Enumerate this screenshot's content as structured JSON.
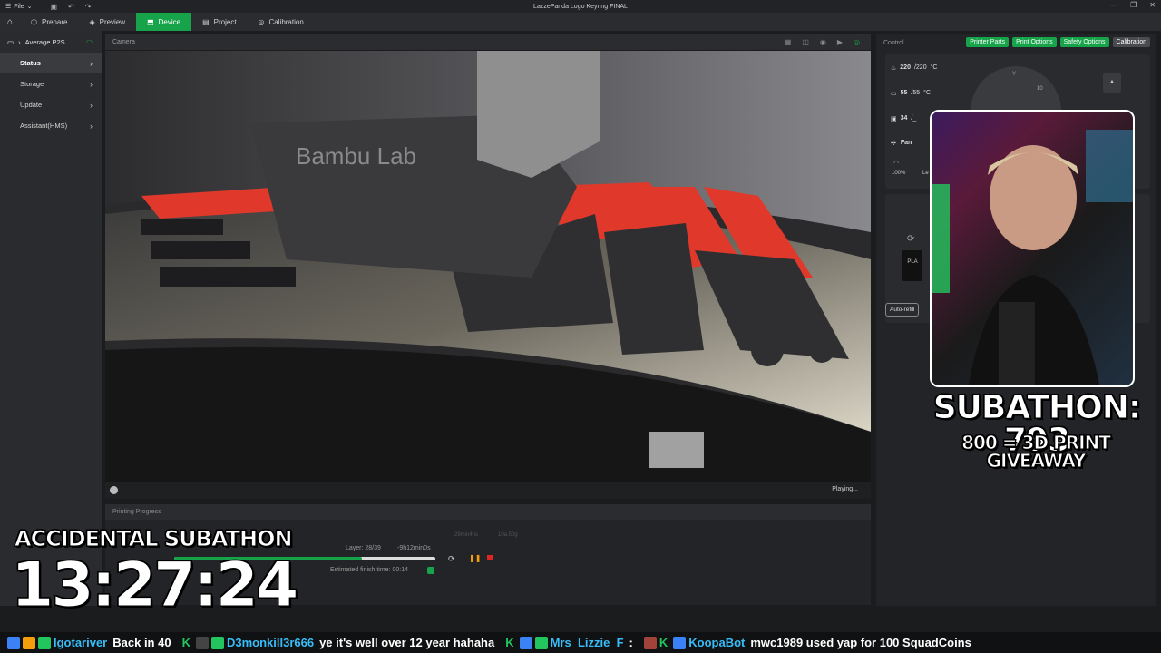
{
  "titlebar": {
    "file_label": "File",
    "window_title": "LazzePanda Logo Keyring FINAL"
  },
  "nav": {
    "tabs": [
      {
        "label": "Prepare",
        "icon": "cube-icon"
      },
      {
        "label": "Preview",
        "icon": "layers-icon"
      },
      {
        "label": "Device",
        "icon": "device-icon",
        "active": true
      },
      {
        "label": "Project",
        "icon": "project-icon"
      },
      {
        "label": "Calibration",
        "icon": "calibration-icon"
      }
    ]
  },
  "sidebar": {
    "device_name": "Average P2S",
    "items": [
      {
        "label": "Status",
        "active": true
      },
      {
        "label": "Storage"
      },
      {
        "label": "Update"
      },
      {
        "label": "Assistant(HMS)"
      }
    ]
  },
  "camera": {
    "header": "Camera",
    "status": "Playing...",
    "brand_print": "Bambu Lab"
  },
  "progress": {
    "header": "Printing Progress",
    "layer": "Layer: 28/39",
    "remaining": "-9h12min0s",
    "finish": "Estimated finish time: 00:14",
    "faint_time": "29min4ns",
    "faint_weight": "10a.50g",
    "percent": 0.72
  },
  "control": {
    "header": "Control",
    "pills": [
      "Printer Parts",
      "Print Options",
      "Safety Options",
      "Calibration"
    ],
    "nozzle_temp": "220",
    "nozzle_target": "/220",
    "bed_temp": "55",
    "bed_target": "/55",
    "chamber_temp": "34",
    "chamber_target": "/_",
    "unit": "°C",
    "fan_label": "Fan",
    "fan_pct": "100%",
    "fan_partial": "Le",
    "ams_label": "PLA",
    "auto_refill": "Auto-refill",
    "dial_y": "Y",
    "dial_10": "10"
  },
  "overlays": {
    "subathon_count": "SUBATHON: 793",
    "giveaway": "800 = 3D PRINT GIVEAWAY",
    "accidental": "ACCIDENTAL SUBATHON",
    "timer": "13:27:24"
  },
  "ticker": [
    {
      "user": "lgotariver",
      "text": "Back in 40",
      "user_color": "#38bdf8"
    },
    {
      "user": "D3monkill3r666",
      "text": "ye it's well over 12 year hahaha",
      "user_color": "#38bdf8"
    },
    {
      "user": "Mrs_Lizzie_F",
      "text": ":",
      "user_color": "#38bdf8"
    },
    {
      "user": "KoopaBot",
      "text": "mwc1989 used yap for 100 SquadCoins",
      "user_color": "#38bdf8"
    }
  ]
}
